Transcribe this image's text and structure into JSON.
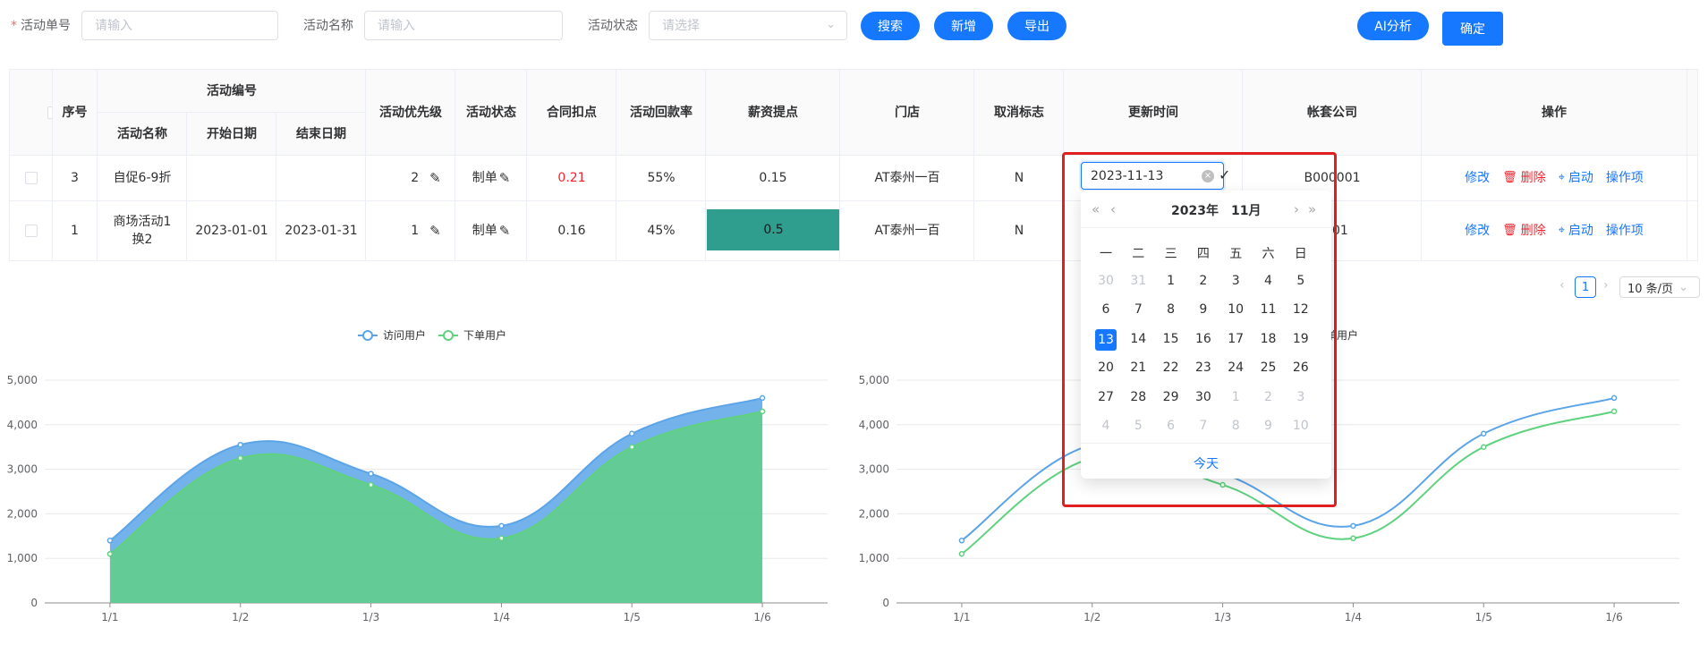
{
  "filters": {
    "required_mark": "*",
    "activity_no_label": "活动单号",
    "activity_no_placeholder": "请输入",
    "activity_name_label": "活动名称",
    "activity_name_placeholder": "请输入",
    "activity_status_label": "活动状态",
    "activity_status_placeholder": "请选择"
  },
  "buttons": {
    "search": "搜索",
    "add": "新增",
    "export": "导出",
    "ai_analysis": "AI分析",
    "confirm": "确定"
  },
  "table": {
    "headers": {
      "index": "序号",
      "activity_code": "活动编号",
      "activity_name": "活动名称",
      "start_date": "开始日期",
      "end_date": "结束日期",
      "priority": "活动优先级",
      "status": "活动状态",
      "contract_discount": "合同扣点",
      "payback_rate": "活动回款率",
      "salary_point": "薪资提点",
      "store": "门店",
      "cancel_flag": "取消标志",
      "update_time": "更新时间",
      "account_company": "帐套公司",
      "actions": "操作"
    },
    "rows": [
      {
        "index": "3",
        "activity_name": "自促6-9折",
        "start_date": "",
        "end_date": "",
        "priority": "2",
        "status": "制单",
        "contract_discount": "0.21",
        "payback_rate": "55%",
        "salary_point": "0.15",
        "store": "AT泰州一百",
        "cancel_flag": "N",
        "update_time": "2023-11-13",
        "account_company": "B000001"
      },
      {
        "index": "1",
        "activity_name": "商场活动1换2",
        "start_date": "2023-01-01",
        "end_date": "2023-01-31",
        "priority": "1",
        "status": "制单",
        "contract_discount": "0.16",
        "payback_rate": "45%",
        "salary_point": "0.5",
        "store": "AT泰州一百",
        "cancel_flag": "N",
        "update_time": "",
        "account_company": "0001"
      }
    ],
    "actions": {
      "edit": "修改",
      "delete": "删除",
      "start": "启动",
      "more": "操作项"
    },
    "colors": {
      "discount_highlight": "#f5222d",
      "salary_highlight_bg": "#2f9e8f"
    }
  },
  "pagination": {
    "current_page": "1",
    "page_size": "10 条/页"
  },
  "date_picker": {
    "year": "2023年",
    "month": "11月",
    "weekdays": [
      "一",
      "二",
      "三",
      "四",
      "五",
      "六",
      "日"
    ],
    "weeks": [
      [
        "30",
        "31",
        "1",
        "2",
        "3",
        "4",
        "5"
      ],
      [
        "6",
        "7",
        "8",
        "9",
        "10",
        "11",
        "12"
      ],
      [
        "13",
        "14",
        "15",
        "16",
        "17",
        "18",
        "19"
      ],
      [
        "20",
        "21",
        "22",
        "23",
        "24",
        "25",
        "26"
      ],
      [
        "27",
        "28",
        "29",
        "30",
        "1",
        "2",
        "3"
      ],
      [
        "4",
        "5",
        "6",
        "7",
        "8",
        "9",
        "10"
      ]
    ],
    "selected": "13",
    "today_label": "今天"
  },
  "chart_data": [
    {
      "type": "area",
      "stacked": true,
      "x": [
        "1/1",
        "1/2",
        "1/3",
        "1/4",
        "1/5",
        "1/6"
      ],
      "series": [
        {
          "name": "访问用户",
          "values": [
            1400,
            3550,
            2900,
            1730,
            3800,
            4600
          ],
          "color": "#5ba4e8"
        },
        {
          "name": "下单用户",
          "values": [
            1100,
            3250,
            2650,
            1450,
            3500,
            4300
          ],
          "color": "#5fd17f"
        }
      ],
      "yticks": [
        "0",
        "1,000",
        "2,000",
        "3,000",
        "4,000",
        "5,000"
      ],
      "ylim": [
        0,
        5000
      ],
      "legend": "top-center",
      "grid": true
    },
    {
      "type": "line",
      "x": [
        "1/1",
        "1/2",
        "1/3",
        "1/4",
        "1/5",
        "1/6"
      ],
      "series": [
        {
          "name": "访问用户",
          "values": [
            1400,
            3550,
            2900,
            1730,
            3800,
            4600
          ],
          "color": "#5ba4e8"
        },
        {
          "name": "下单用户",
          "values": [
            1100,
            3250,
            2650,
            1450,
            3500,
            4300
          ],
          "color": "#5fd17f"
        }
      ],
      "yticks": [
        "0",
        "1,000",
        "2,000",
        "3,000",
        "4,000",
        "5,000"
      ],
      "ylim": [
        0,
        5000
      ],
      "legend": "top-center",
      "grid": true
    }
  ]
}
